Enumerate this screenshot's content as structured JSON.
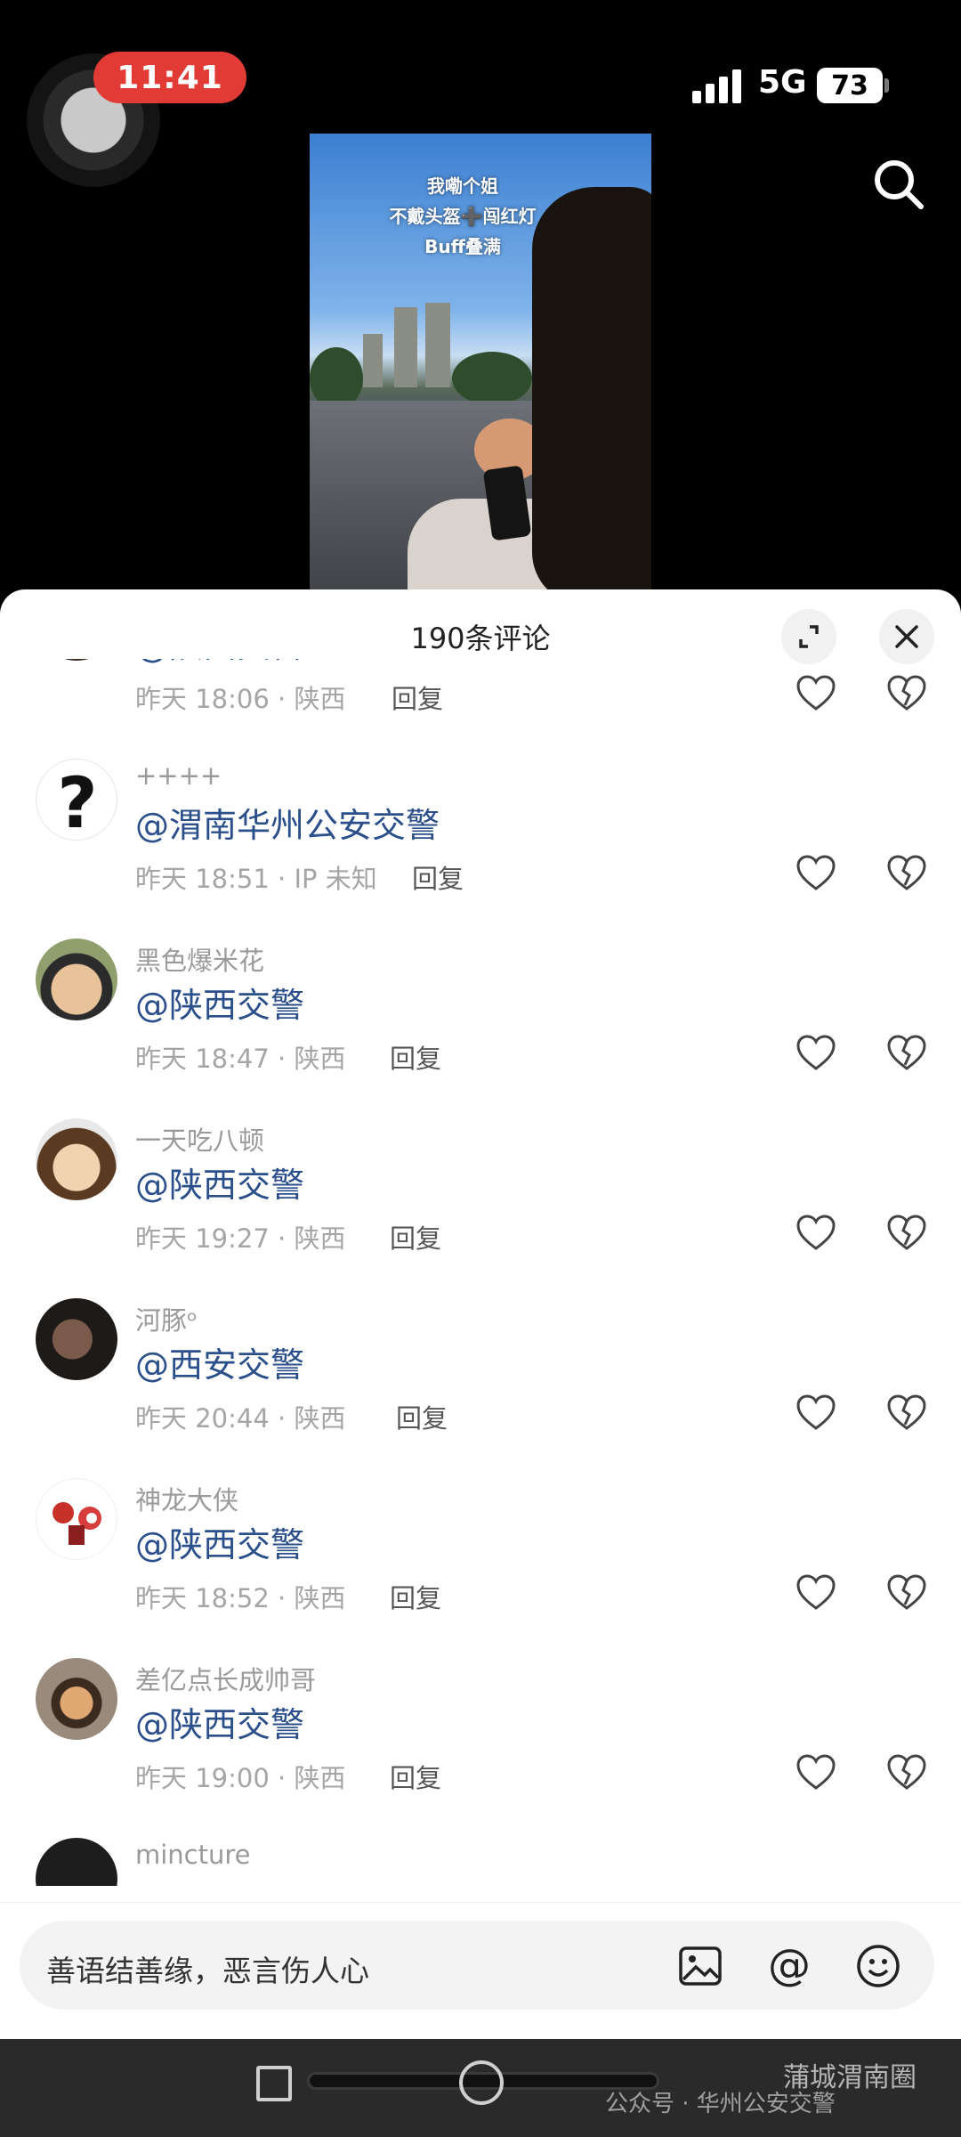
{
  "status": {
    "time": "11:41",
    "network": "5G",
    "battery": "73"
  },
  "video": {
    "caption_lines": [
      "我嘞个姐",
      "不戴头盔➕闯红灯",
      "Buff叠满"
    ]
  },
  "sheet": {
    "title": "190条评论"
  },
  "partial_comment": {
    "text": "@陕西交警",
    "time_location": "昨天 18:06 · 陕西",
    "reply": "回复"
  },
  "comments": [
    {
      "user": "++++",
      "text": "@渭南华州公安交警",
      "time_location": "昨天 18:51 · IP 未知",
      "reply": "回复"
    },
    {
      "user": "黑色爆米花",
      "text": "@陕西交警",
      "time_location": "昨天 18:47 · 陕西",
      "reply": "回复"
    },
    {
      "user": "一天吃八顿",
      "text": "@陕西交警",
      "time_location": "昨天 19:27 · 陕西",
      "reply": "回复"
    },
    {
      "user": "河豚ᵒ",
      "text": "@西安交警",
      "time_location": "昨天 20:44 · 陕西",
      "reply": "回复"
    },
    {
      "user": "神龙大侠",
      "text": "@陕西交警",
      "time_location": "昨天 18:52 · 陕西",
      "reply": "回复"
    },
    {
      "user": "差亿点长成帅哥",
      "text": "@陕西交警",
      "time_location": "昨天 19:00 · 陕西",
      "reply": "回复"
    }
  ],
  "last_user": "mincture",
  "input": {
    "placeholder": "善语结善缘，恶言伤人心"
  },
  "watermark": {
    "account": "公众号 · 华州公安交警",
    "brand": "蒲城渭南圈"
  },
  "colors": {
    "mention": "#2b4f8a",
    "recording": "#e23b35",
    "meta": "#a5a5a5"
  }
}
